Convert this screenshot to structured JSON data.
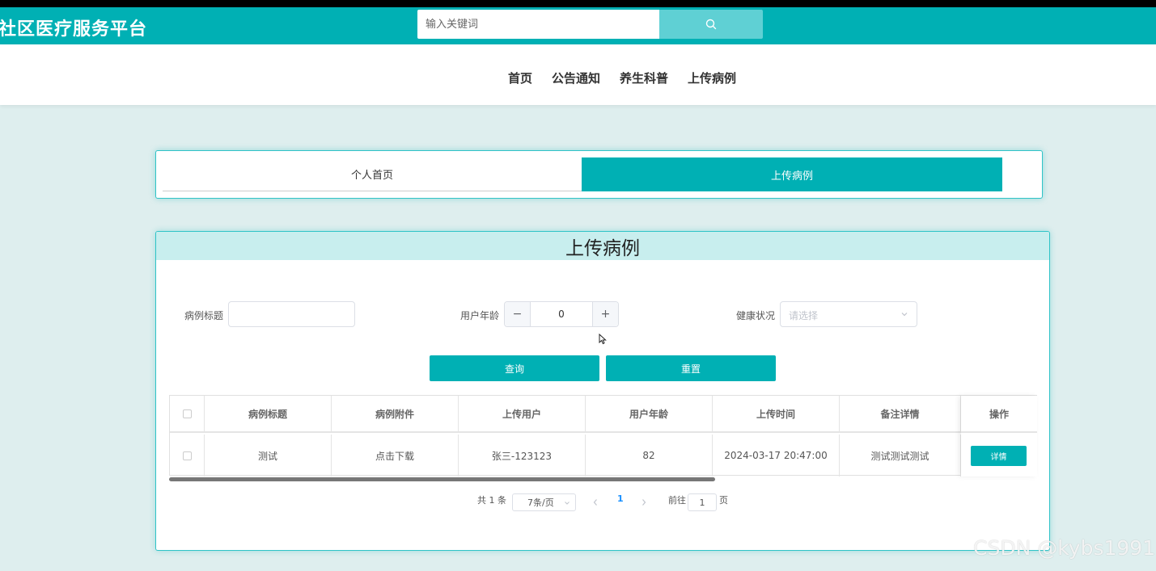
{
  "header": {
    "brand": "社区医疗服务平台",
    "search_placeholder": "输入关键词",
    "accent_color": "#00b0b4"
  },
  "nav": {
    "items": [
      {
        "label": "首页"
      },
      {
        "label": "公告通知"
      },
      {
        "label": "养生科普"
      },
      {
        "label": "上传病例"
      }
    ]
  },
  "tabs": [
    {
      "label": "个人首页",
      "active": false
    },
    {
      "label": "上传病例",
      "active": true
    }
  ],
  "panel": {
    "title": "上传病例",
    "filters": {
      "title_label": "病例标题",
      "title_value": "",
      "age_label": "用户年龄",
      "age_value": "0",
      "health_label": "健康状况",
      "health_placeholder": "请选择"
    },
    "buttons": {
      "query": "查询",
      "reset": "重置"
    },
    "table": {
      "headers": [
        "病例标题",
        "病例附件",
        "上传用户",
        "用户年龄",
        "上传时间",
        "备注详情",
        "操作"
      ],
      "rows": [
        {
          "title": "测试",
          "attachment": "点击下载",
          "user": "张三-123123",
          "age": "82",
          "time": "2024-03-17 20:47:00",
          "remark": "测试测试测试",
          "action": "详情"
        }
      ]
    },
    "pagination": {
      "total": "共 1 条",
      "page_size": "7条/页",
      "current": "1",
      "goto_prefix": "前往",
      "goto_value": "1",
      "goto_suffix": "页"
    }
  },
  "watermark": "CSDN @kybs1991",
  "icons": {
    "search": "search-icon",
    "minus": "minus-icon",
    "plus": "plus-icon",
    "dropdown": "chevron-down-icon",
    "prev": "chevron-left-icon",
    "next": "chevron-right-icon"
  }
}
